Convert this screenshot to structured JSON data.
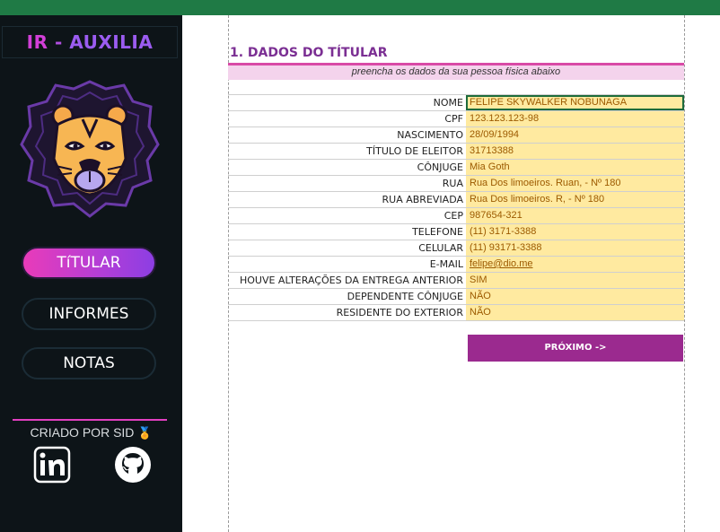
{
  "sidebar": {
    "brand": {
      "ir": "IR",
      "sep": " - ",
      "aux": "AUXILIA"
    },
    "nav": [
      {
        "label": "TíTULAR",
        "active": true
      },
      {
        "label": "INFORMES",
        "active": false
      },
      {
        "label": "NOTAS",
        "active": false
      }
    ],
    "credit": "CRIADO POR SID",
    "credit_icon": "medal-icon",
    "social": [
      "linkedin-icon",
      "github-icon"
    ]
  },
  "sheet": {
    "section_title": "1. DADOS DO TÍTULAR",
    "subtitle": "preencha os dados da sua pessoa física abaixo",
    "fields": [
      {
        "label": "NOME",
        "value": "FELIPE SKYWALKER NOBUNAGA"
      },
      {
        "label": "CPF",
        "value": "123.123.123-98"
      },
      {
        "label": "NASCIMENTO",
        "value": "28/09/1994"
      },
      {
        "label": "TÍTULO DE ELEITOR",
        "value": "31713388"
      },
      {
        "label": "CÔNJUGE",
        "value": "Mia Goth"
      },
      {
        "label": "RUA",
        "value": "Rua Dos limoeiros. Ruan, - Nº 180"
      },
      {
        "label": "RUA ABREVIADA",
        "value": "Rua Dos limoeiros. R, - Nº 180"
      },
      {
        "label": "CEP",
        "value": "987654-321"
      },
      {
        "label": "TELEFONE",
        "value": "(11) 3171-3388"
      },
      {
        "label": "CELULAR",
        "value": "(11) 93171-3388"
      },
      {
        "label": "E-MAIL",
        "value": "felipe@dio.me"
      },
      {
        "label": "HOUVE ALTERAÇÕES DA ENTREGA ANTERIOR",
        "value": "SIM"
      },
      {
        "label": "DEPENDENTE CÔNJUGE",
        "value": "NÃO"
      },
      {
        "label": "RESIDENTE DO EXTERIOR",
        "value": "NÃO"
      }
    ],
    "next_label": "PRÓXIMO ->"
  },
  "colors": {
    "topbar": "#1f7a45",
    "sidebar_bg": "#0d1418",
    "accent_pink": "#e13fc0",
    "accent_purple": "#9b2a8f",
    "field_fill": "#ffeaa0"
  }
}
